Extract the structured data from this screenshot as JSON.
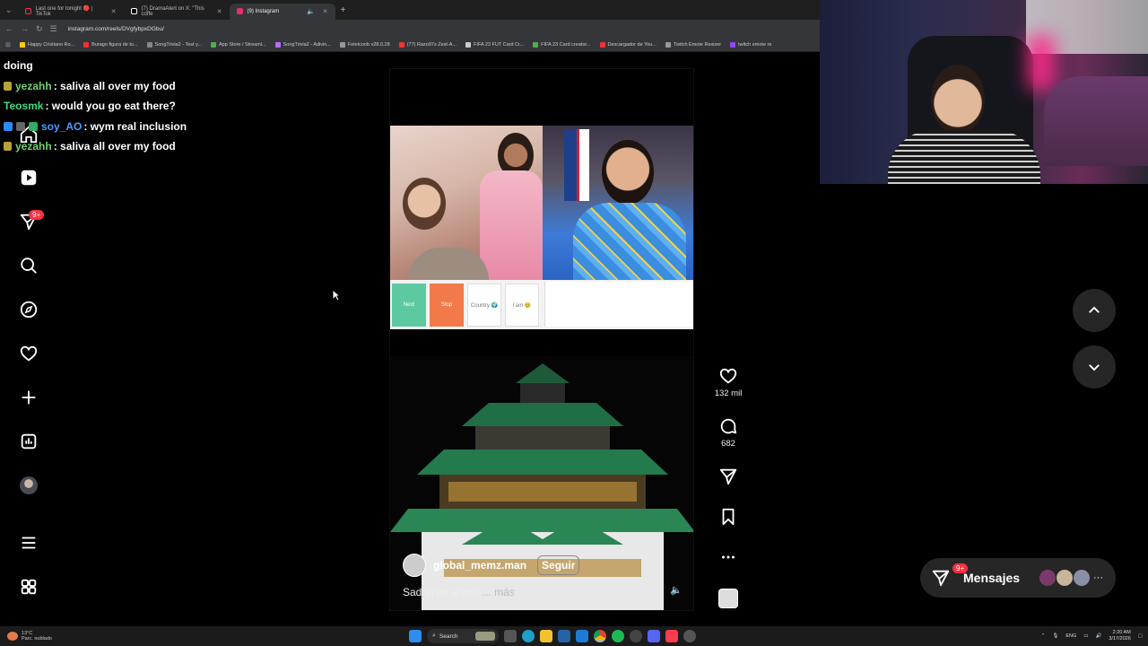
{
  "browser": {
    "tabs": [
      {
        "title": "Last one for tonight 🔴 | TikTok",
        "color": "#ff2d55",
        "active": false
      },
      {
        "title": "(7) DramaAlert on X: \"This coffe",
        "color": "#ffffff",
        "active": false
      },
      {
        "title": "(9) Instagram",
        "color": "#e1306c",
        "active": true
      }
    ],
    "new_tab": "+",
    "url": "instagram.com/reels/DVgfybpxDGbu/",
    "bookmarks": [
      {
        "label": "Happy Cristiano Ro...",
        "color": "#ffcc00"
      },
      {
        "label": "Burago figura de to...",
        "color": "#e33"
      },
      {
        "label": "SongTrivia2 - Test y...",
        "color": "#888"
      },
      {
        "label": "App Store / Streaml...",
        "color": "#4caf50"
      },
      {
        "label": "SongTrivia2 - Adivin...",
        "color": "#b36bff"
      },
      {
        "label": "Feletcoob v28.0.28",
        "color": "#999"
      },
      {
        "label": "(77) Razo97s Zest-A...",
        "color": "#e33"
      },
      {
        "label": "FIFA 23 FUT Card Cr...",
        "color": "#ccc"
      },
      {
        "label": "FIFA 23 Card creator...",
        "color": "#4caf50"
      },
      {
        "label": "Descargador de You...",
        "color": "#e33"
      },
      {
        "label": "Twitch Emote Resizer",
        "color": "#999"
      },
      {
        "label": "twitch emote re",
        "color": "#9146ff"
      }
    ]
  },
  "chat": [
    {
      "user": "",
      "user_color": "#ffffff",
      "message": "doing"
    },
    {
      "user": "yezahh",
      "user_color": "#6fd36f",
      "message": ": saliva all over my food"
    },
    {
      "user": "Teosmk",
      "user_color": "#3ddc84",
      "message": ": would you go eat there?"
    },
    {
      "user": "soy_AO",
      "user_color": "#4a9cff",
      "message": ": wym real inclusion"
    },
    {
      "user": "yezahh",
      "user_color": "#6fd36f",
      "message": ": saliva all over my food"
    }
  ],
  "nav": {
    "notifications_badge": "9+"
  },
  "reel": {
    "overlay_buttons": [
      "Next",
      "Stop",
      "Country 🌍",
      "I am 😊"
    ],
    "username": "global_memz.man",
    "follow_label": "Seguir",
    "caption": "Sad to be a true",
    "caption_more": "... más",
    "likes": "132 mil",
    "comments": "682"
  },
  "messages": {
    "label": "Mensajes",
    "badge": "9+"
  },
  "taskbar": {
    "temp": "13°C",
    "weather": "Parc. nublado",
    "search": "Search",
    "lang": "ENG",
    "time": "2:20 AM",
    "date": "3/17/2026"
  },
  "colors": {
    "accent_red": "#ff3040",
    "panel_bg": "#262626"
  }
}
